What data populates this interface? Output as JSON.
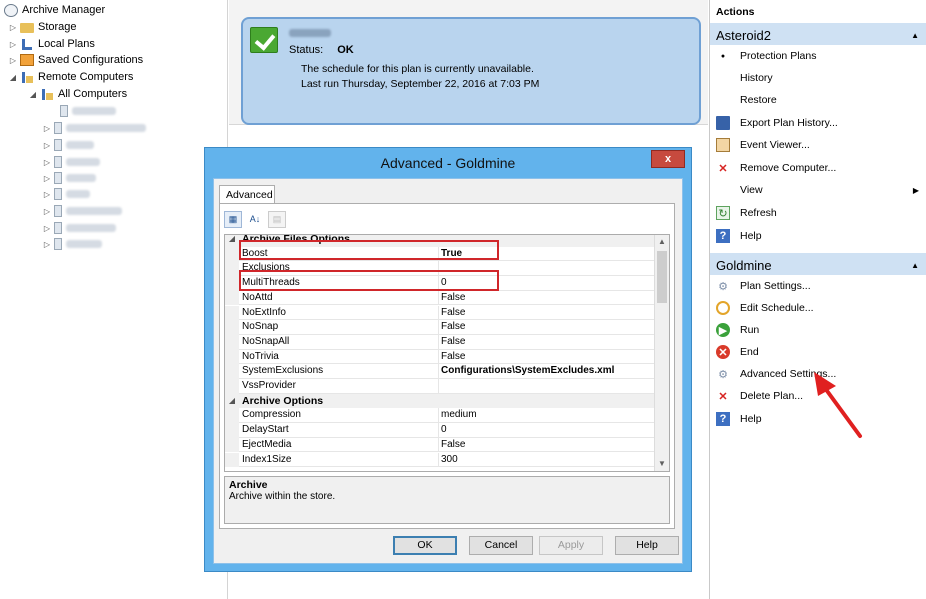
{
  "tree": {
    "root": "Archive Manager",
    "items": [
      {
        "label": "Storage"
      },
      {
        "label": "Local Plans"
      },
      {
        "label": "Saved Configurations"
      },
      {
        "label": "Remote Computers"
      },
      {
        "label": "All Computers"
      }
    ]
  },
  "plan": {
    "status_label": "Status:",
    "status_value": "OK",
    "line1": "The schedule for this plan is currently unavailable.",
    "line2": "Last run Thursday, September 22, 2016 at 7:03 PM"
  },
  "actions": {
    "header": "Actions",
    "section1_title": "Asteroid2",
    "section1_items": [
      {
        "label": "Protection Plans",
        "icon": "bullet-icon"
      },
      {
        "label": "History",
        "icon": ""
      },
      {
        "label": "Restore",
        "icon": ""
      },
      {
        "label": "Export Plan History...",
        "icon": "export-icon"
      },
      {
        "label": "Event Viewer...",
        "icon": "event-viewer-icon"
      },
      {
        "label": "Remove Computer...",
        "icon": "red-x-icon"
      },
      {
        "label": "View",
        "icon": ""
      },
      {
        "label": "Refresh",
        "icon": "refresh-icon"
      },
      {
        "label": "Help",
        "icon": "help-icon"
      }
    ],
    "section2_title": "Goldmine",
    "section2_items": [
      {
        "label": "Plan Settings...",
        "icon": "gear-icon"
      },
      {
        "label": "Edit Schedule...",
        "icon": "clock-icon"
      },
      {
        "label": "Run",
        "icon": "run-icon"
      },
      {
        "label": "End",
        "icon": "end-icon"
      },
      {
        "label": "Advanced Settings...",
        "icon": "gear-icon"
      },
      {
        "label": "Delete Plan...",
        "icon": "red-x-icon"
      },
      {
        "label": "Help",
        "icon": "help-icon"
      }
    ]
  },
  "dialog": {
    "title": "Advanced - Goldmine",
    "close": "x",
    "tab": "Advanced",
    "properties": [
      {
        "type": "category",
        "name": "Archive Files Options"
      },
      {
        "type": "prop",
        "name": "Boost",
        "value": "True",
        "bold": true
      },
      {
        "type": "prop",
        "name": "Exclusions",
        "value": ""
      },
      {
        "type": "prop",
        "name": "MultiThreads",
        "value": "0"
      },
      {
        "type": "prop",
        "name": "NoAttd",
        "value": "False"
      },
      {
        "type": "prop",
        "name": "NoExtInfo",
        "value": "False"
      },
      {
        "type": "prop",
        "name": "NoSnap",
        "value": "False"
      },
      {
        "type": "prop",
        "name": "NoSnapAll",
        "value": "False"
      },
      {
        "type": "prop",
        "name": "NoTrivia",
        "value": "False"
      },
      {
        "type": "prop",
        "name": "SystemExclusions",
        "value": "Configurations\\SystemExcludes.xml",
        "bold": true
      },
      {
        "type": "prop",
        "name": "VssProvider",
        "value": ""
      },
      {
        "type": "category",
        "name": "Archive Options"
      },
      {
        "type": "prop",
        "name": "Compression",
        "value": "medium"
      },
      {
        "type": "prop",
        "name": "DelayStart",
        "value": "0"
      },
      {
        "type": "prop",
        "name": "EjectMedia",
        "value": "False"
      },
      {
        "type": "prop",
        "name": "Index1Size",
        "value": "300"
      }
    ],
    "description_title": "Archive",
    "description_text": "Archive within the store.",
    "buttons": {
      "ok": "OK",
      "cancel": "Cancel",
      "apply": "Apply",
      "help": "Help"
    }
  },
  "colors": {
    "plan_card_bg": "#b9d4ee",
    "action_section_bg": "#cfe1f3",
    "dialog_frame": "#62b3ec",
    "highlight_red": "#d0262a"
  }
}
